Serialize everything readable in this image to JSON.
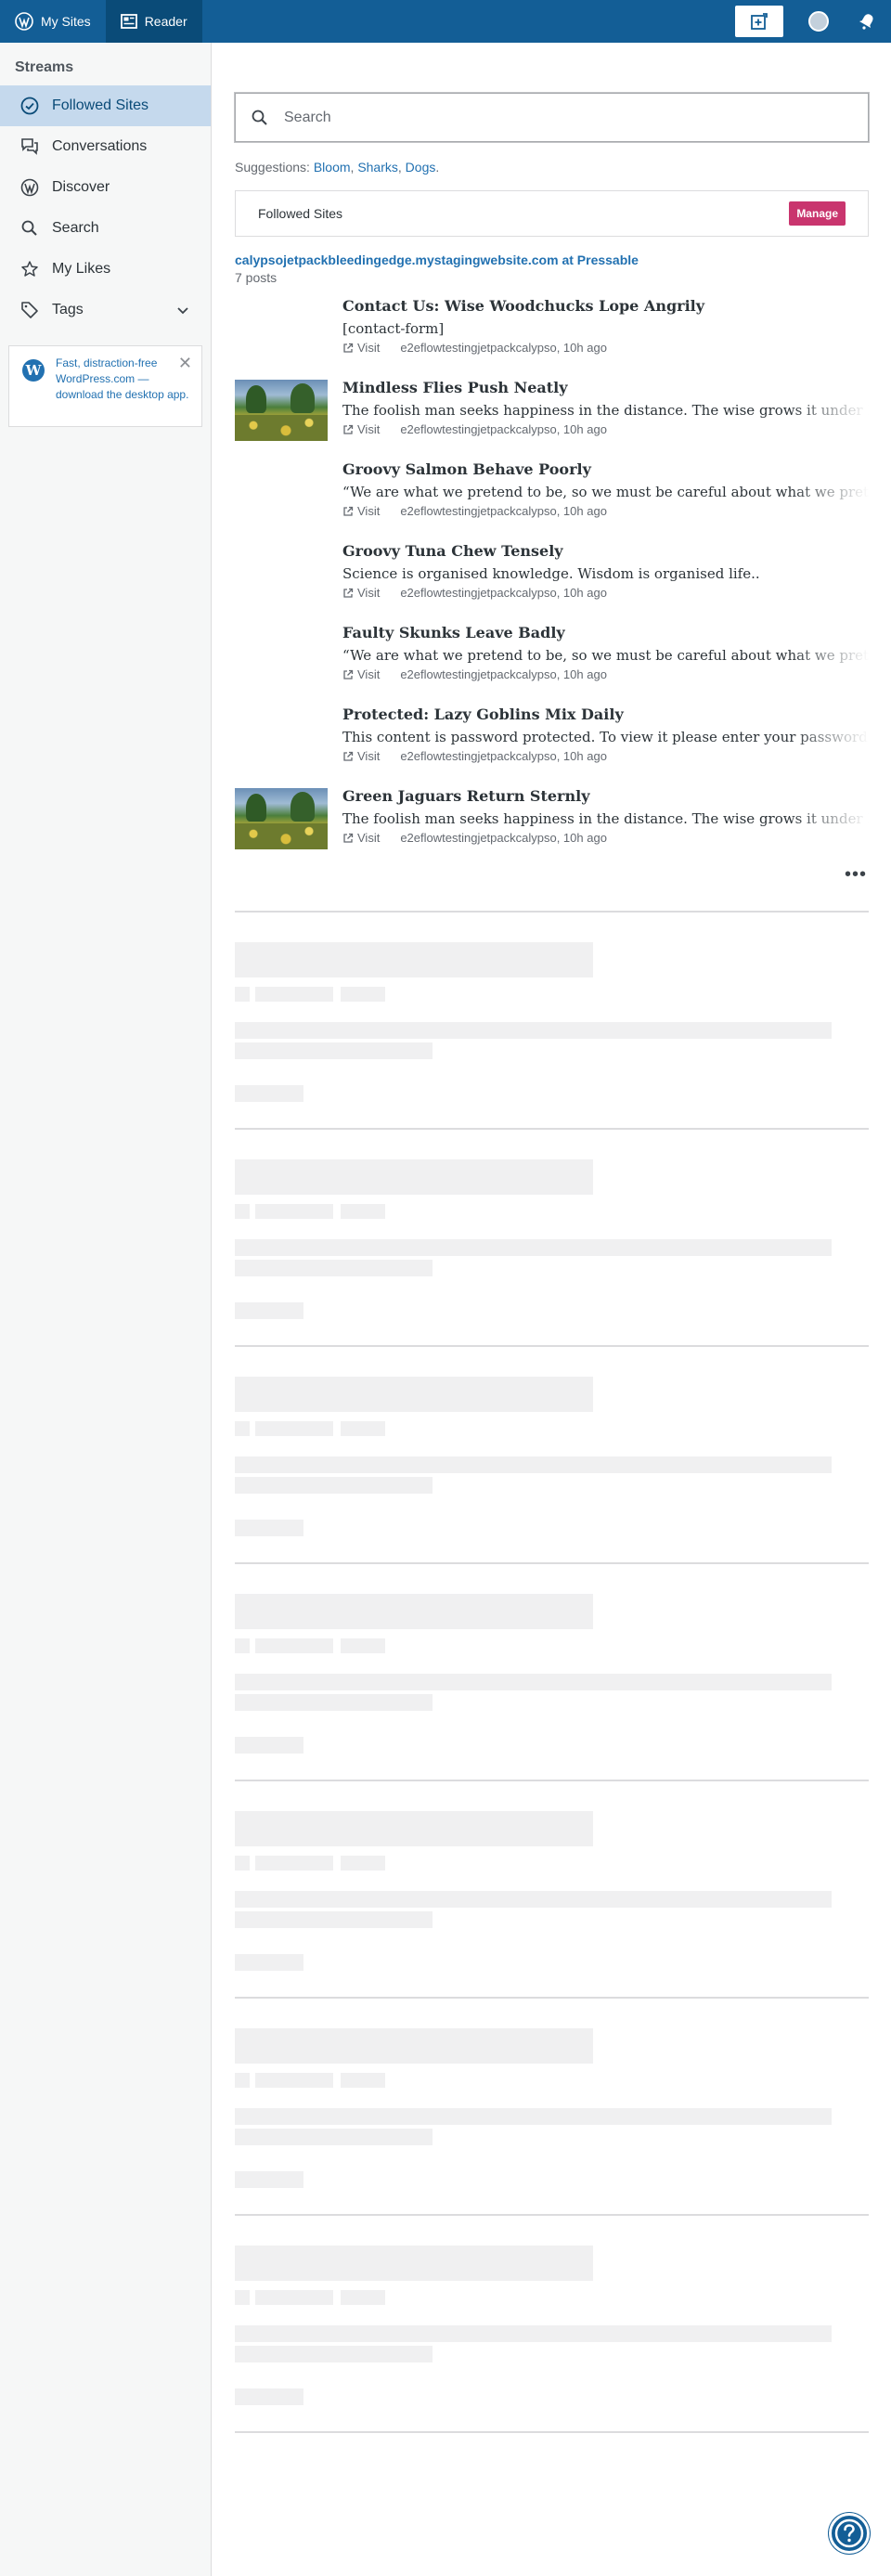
{
  "masterbar": {
    "my_sites": "My Sites",
    "reader": "Reader"
  },
  "sidebar": {
    "heading": "Streams",
    "items": [
      {
        "label": "Followed Sites",
        "icon": "checkmark-circle-icon"
      },
      {
        "label": "Conversations",
        "icon": "chat-bubbles-icon"
      },
      {
        "label": "Discover",
        "icon": "wordpress-logo-icon"
      },
      {
        "label": "Search",
        "icon": "search-icon"
      },
      {
        "label": "My Likes",
        "icon": "star-icon"
      },
      {
        "label": "Tags",
        "icon": "tag-icon"
      }
    ],
    "promo_text": "Fast, distraction-free WordPress.com — download the desktop app."
  },
  "search": {
    "placeholder": "Search"
  },
  "suggestions": {
    "label": "Suggestions:",
    "items": [
      "Bloom",
      "Sharks",
      "Dogs"
    ]
  },
  "followed": {
    "label": "Followed Sites",
    "manage": "Manage"
  },
  "site": {
    "name": "calypsojetpackbleedingedge.mystagingwebsite.com at Pressable",
    "post_count": "7 posts"
  },
  "post_common": {
    "visit": "Visit",
    "meta": "e2eflowtestingjetpackcalypso, 10h ago"
  },
  "posts": [
    {
      "title": "Contact Us: Wise Woodchucks Lope Angrily",
      "excerpt": "[contact-form]",
      "has_thumb": false
    },
    {
      "title": "Mindless Flies Push Neatly",
      "excerpt": "The foolish man seeks happiness in the distance. The wise grows it under his feet.",
      "has_thumb": true
    },
    {
      "title": "Groovy Salmon Behave Poorly",
      "excerpt": "“We are what we pretend to be, so we must be careful about what we pretend to be.”",
      "has_thumb": false
    },
    {
      "title": "Groovy Tuna Chew Tensely",
      "excerpt": "Science is organised knowledge. Wisdom is organised life..",
      "has_thumb": false
    },
    {
      "title": "Faulty Skunks Leave Badly",
      "excerpt": "“We are what we pretend to be, so we must be careful about what we pretend to be.”",
      "has_thumb": false
    },
    {
      "title": "Protected: Lazy Goblins Mix Daily",
      "excerpt": "This content is password protected. To view it please enter your password below:",
      "has_thumb": false
    },
    {
      "title": "Green Jaguars Return Sternly",
      "excerpt": "The foolish man seeks happiness in the distance. The wise grows it under his feet.",
      "has_thumb": true
    }
  ]
}
